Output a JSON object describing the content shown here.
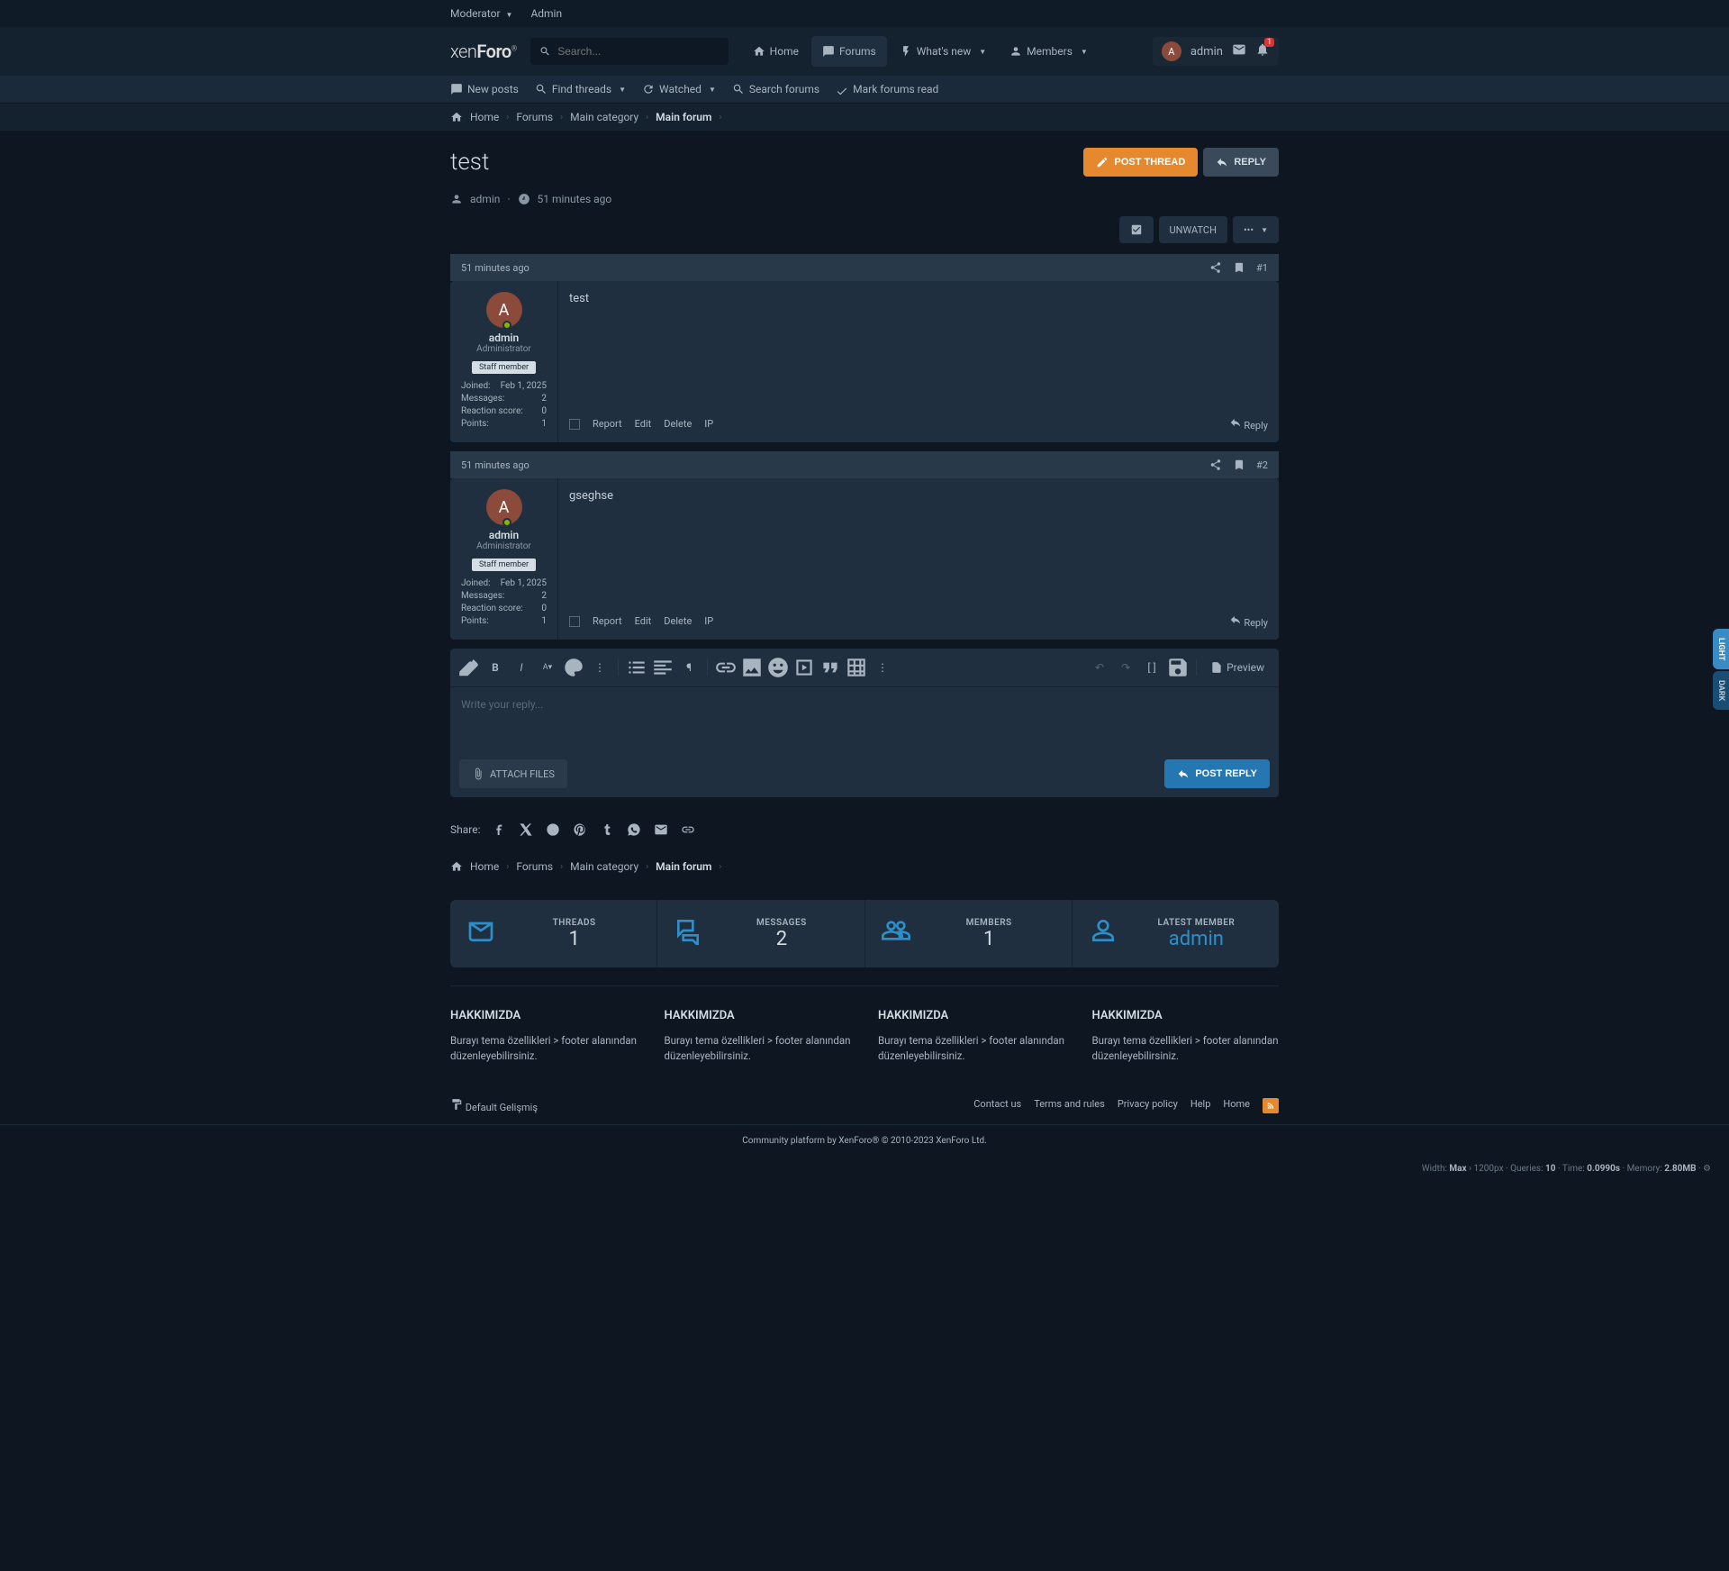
{
  "topbar": {
    "moderator": "Moderator",
    "admin": "Admin"
  },
  "header": {
    "search_placeholder": "Search...",
    "tabs": {
      "home": "Home",
      "forums": "Forums",
      "whatsnew": "What's new",
      "members": "Members"
    },
    "user": "admin",
    "alert_count": "1"
  },
  "subnav": {
    "newposts": "New posts",
    "findthreads": "Find threads",
    "watched": "Watched",
    "searchforums": "Search forums",
    "markread": "Mark forums read"
  },
  "breadcrumb": {
    "home": "Home",
    "forums": "Forums",
    "category": "Main category",
    "forum": "Main forum"
  },
  "thread": {
    "title": "test",
    "author": "admin",
    "time": "51 minutes ago"
  },
  "actions": {
    "post_thread": "POST THREAD",
    "reply": "REPLY",
    "unwatch": "UNWATCH",
    "post_reply": "POST REPLY",
    "attach": "ATTACH FILES",
    "preview": "Preview"
  },
  "posts": [
    {
      "time": "51 minutes ago",
      "num": "#1",
      "avatar": "A",
      "username": "admin",
      "role": "Administrator",
      "badge": "Staff member",
      "stats": {
        "joined_l": "Joined:",
        "joined_v": "Feb 1, 2025",
        "messages_l": "Messages:",
        "messages_v": "2",
        "reaction_l": "Reaction score:",
        "reaction_v": "0",
        "points_l": "Points:",
        "points_v": "1"
      },
      "content": "test",
      "footer": {
        "report": "Report",
        "edit": "Edit",
        "delete": "Delete",
        "ip": "IP",
        "reply": "Reply"
      }
    },
    {
      "time": "51 minutes ago",
      "num": "#2",
      "avatar": "A",
      "username": "admin",
      "role": "Administrator",
      "badge": "Staff member",
      "stats": {
        "joined_l": "Joined:",
        "joined_v": "Feb 1, 2025",
        "messages_l": "Messages:",
        "messages_v": "2",
        "reaction_l": "Reaction score:",
        "reaction_v": "0",
        "points_l": "Points:",
        "points_v": "1"
      },
      "content": "gseghse",
      "footer": {
        "report": "Report",
        "edit": "Edit",
        "delete": "Delete",
        "ip": "IP",
        "reply": "Reply"
      }
    }
  ],
  "editor": {
    "placeholder": "Write your reply..."
  },
  "share": {
    "label": "Share:"
  },
  "stats": {
    "threads": {
      "label": "THREADS",
      "value": "1"
    },
    "messages": {
      "label": "MESSAGES",
      "value": "2"
    },
    "members": {
      "label": "MEMBERS",
      "value": "1"
    },
    "latest": {
      "label": "LATEST MEMBER",
      "value": "admin"
    }
  },
  "footer": {
    "cols": [
      {
        "title": "HAKKIMIZDA",
        "text": "Burayı tema özellikleri > footer alanından düzenleyebilirsiniz."
      },
      {
        "title": "HAKKIMIZDA",
        "text": "Burayı tema özellikleri > footer alanından düzenleyebilirsiniz."
      },
      {
        "title": "HAKKIMIZDA",
        "text": "Burayı tema özellikleri > footer alanından düzenleyebilirsiniz."
      },
      {
        "title": "HAKKIMIZDA",
        "text": "Burayı tema özellikleri > footer alanından düzenleyebilirsiniz."
      }
    ],
    "style": "Default Gelişmiş",
    "links": {
      "contact": "Contact us",
      "terms": "Terms and rules",
      "privacy": "Privacy policy",
      "help": "Help",
      "home": "Home",
      "rss": "RSS"
    },
    "copyright": "Community platform by XenForo® © 2010-2023 XenForo Ltd."
  },
  "debug": {
    "width_l": "Width:",
    "width_v": "Max",
    "px": "1200px",
    "queries_l": "Queries:",
    "queries_v": "10",
    "time_l": "Time:",
    "time_v": "0.0990s",
    "memory_l": "Memory:",
    "memory_v": "2.80MB"
  },
  "theme": {
    "light": "LIGHT",
    "dark": "DARK"
  }
}
